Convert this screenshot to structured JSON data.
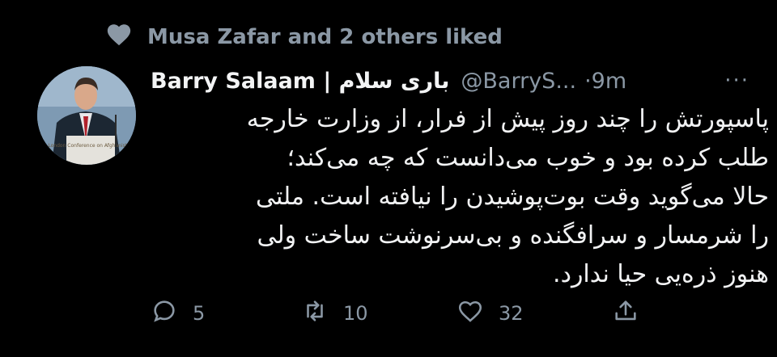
{
  "social_context": {
    "text": "Musa Zafar and 2 others liked",
    "icon": "heart-icon"
  },
  "tweet": {
    "author_name": "Barry Salaam | باری سلام",
    "handle": "@BarryS...",
    "time": "·9m",
    "more_label": "···",
    "text_lines": [
      "پاسپورتش را چند روز پیش از فرار، از وزارت خارجه",
      "طلب کرده بود و خوب می‌دانست که چه می‌کند؛",
      "حالا می‌گوید وقت بوت‌پوشیدن را نیافته است. ملتی",
      "را شرمسار و سرافگنده و بی‌سرنوشت ساخت ولی",
      "هنوز ذره‌یی حیا ندارد."
    ],
    "avatar_sign_text": "London Conference on Afghanistan"
  },
  "actions": {
    "reply_count": "5",
    "retweet_count": "10",
    "like_count": "32"
  },
  "colors": {
    "background": "#000000",
    "text": "#e7e9ea",
    "muted": "#8b98a5"
  }
}
